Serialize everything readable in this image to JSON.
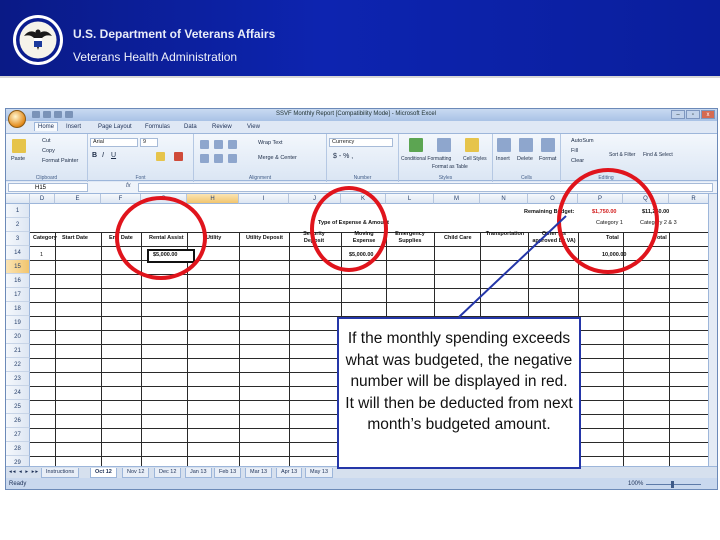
{
  "banner": {
    "title": "U.S. Department of Veterans Affairs",
    "subtitle": "Veterans Health Administration",
    "logo_icon": "va-seal-icon"
  },
  "excel": {
    "window_title": "SSVF Monthly Report [Compatibility Mode] - Microsoft Excel",
    "window_buttons": [
      "–",
      "▫",
      "x"
    ],
    "ribbon_tabs": [
      "Home",
      "Insert",
      "Page Layout",
      "Formulas",
      "Data",
      "Review",
      "View"
    ],
    "active_tab": "Home",
    "ribbon": {
      "paste": "Paste",
      "cut": "Cut",
      "copy": "Copy",
      "format_painter": "Format Painter",
      "clipboard": "Clipboard",
      "font_name": "Arial",
      "font_size": "9",
      "font": "Font",
      "wrap_text": "Wrap Text",
      "merge_center": "Merge & Center",
      "alignment": "Alignment",
      "number_format": "Currency",
      "number": "Number",
      "conditional_formatting": "Conditional Formatting",
      "format_as_table": "Format as Table",
      "cell_styles": "Cell Styles",
      "styles": "Styles",
      "insert": "Insert",
      "delete": "Delete",
      "format": "Format",
      "cells": "Cells",
      "autosum": "AutoSum",
      "fill": "Fill",
      "clear": "Clear",
      "sort_filter": "Sort & Filter",
      "find_select": "Find & Select",
      "editing": "Editing"
    },
    "name_box": "H15",
    "fx": "fx",
    "columns": [
      "D",
      "E",
      "F",
      "G",
      "H",
      "I",
      "J",
      "K",
      "L",
      "M",
      "N",
      "O",
      "P",
      "Q",
      "R"
    ],
    "rows": [
      "1",
      "2",
      "3",
      "14",
      "15",
      "16",
      "17",
      "18",
      "19",
      "20",
      "21",
      "22",
      "23",
      "24",
      "25",
      "26",
      "27",
      "28",
      "29"
    ],
    "cells": {
      "remaining_budget_label": "Remaining Budget:",
      "remaining_budget_value_1": "$1,750.00",
      "remaining_budget_value_2": "$11,250.00",
      "type_of_expense": "Type of Expense & Amount",
      "category_1": "Category 1",
      "category_2_3": "Category 2 & 3",
      "headers": [
        "Category",
        "Start Date",
        "End Date",
        "Rental Assist",
        "Utility",
        "Utility Deposit",
        "Security Deposit",
        "Moving Expense",
        "Emergency Supplies",
        "Child Care",
        "Transportation",
        "Other (as approved by VA)",
        "Total",
        "Total"
      ],
      "row14_category": "1",
      "rental_assist_value": "$5,000.00",
      "moving_expense_value": "$5,000.00",
      "total_value": "10,000.00"
    },
    "sheet_tabs": [
      "Instructions",
      "Oct 12",
      "Nov 12",
      "Dec 12",
      "Jan 13",
      "Feb 13",
      "Mar 13",
      "Apr 13",
      "May 13"
    ],
    "active_sheet": "Oct 12",
    "status": "Ready",
    "zoom": "100%"
  },
  "callout": {
    "text": "If the monthly spending exceeds what was budgeted, the negative number will be displayed in red. It will then be deducted from next month’s budgeted amount."
  },
  "colors": {
    "banner_blue": "#0d24b0",
    "highlight_red": "#e0141c",
    "callout_border": "#2436a8",
    "negative_red": "#d21a1a"
  }
}
